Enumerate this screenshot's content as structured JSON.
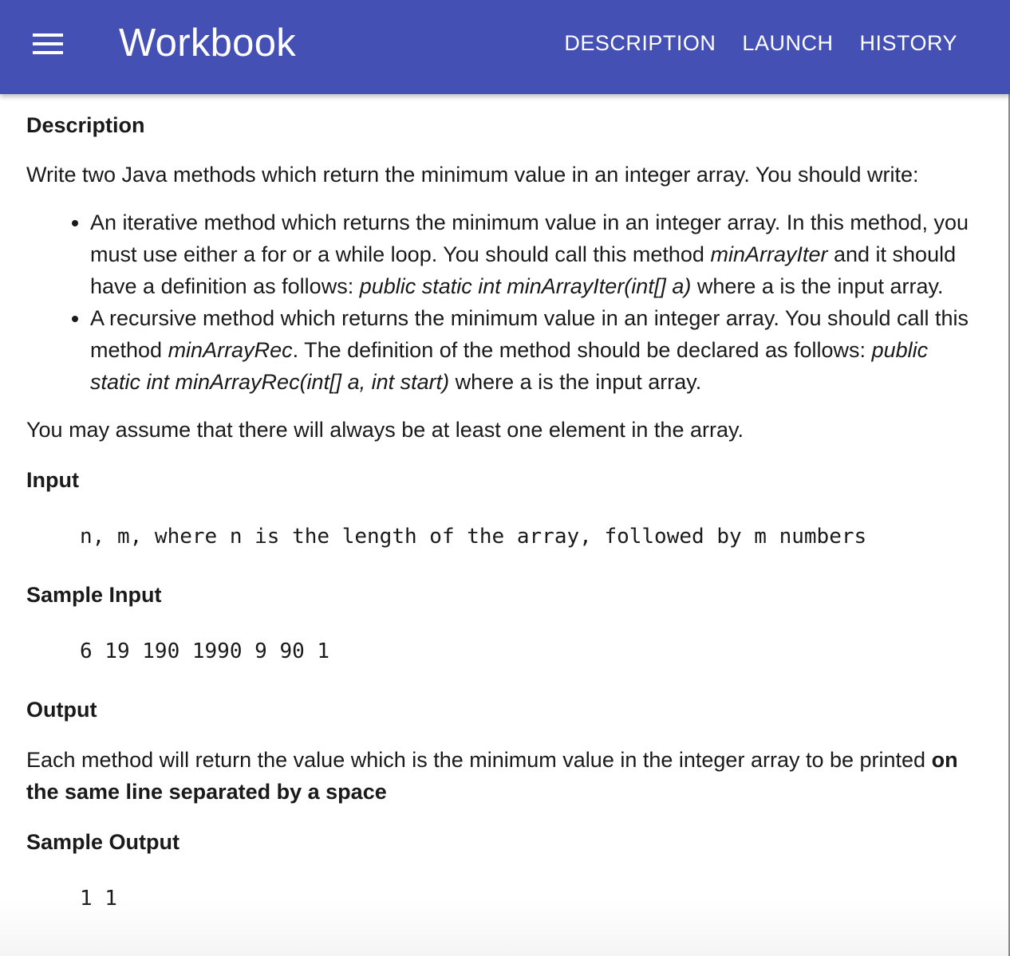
{
  "appbar": {
    "title": "Workbook",
    "nav": [
      "DESCRIPTION",
      "LAUNCH",
      "HISTORY"
    ]
  },
  "colors": {
    "appbar": "#4450b3",
    "text": "#1a1a1a"
  },
  "icons": {
    "menu": "hamburger-menu-icon"
  },
  "content": {
    "description_heading": "Description",
    "intro": "Write two Java methods which return the minimum value in an integer array. You should write:",
    "bullet1": {
      "t1": "An iterative method which returns the minimum value in an integer array. In this method, you must use either a for or a while loop. You should call this method ",
      "name": "minArrayIter",
      "t2": " and it should have a definition as follows: ",
      "signature": "public static int minArrayIter(int[] a)",
      "t3": " where a is the input array."
    },
    "bullet2": {
      "t1": "A recursive method which returns the minimum value in an integer array. You should call this method ",
      "name": "minArrayRec",
      "t2": ". The definition of the method should be declared as follows: ",
      "signature": "public static int minArrayRec(int[] a, int start)",
      "t3": " where a is the input array."
    },
    "assumption": "You may assume that there will always be at least one element in the array.",
    "input_heading": "Input",
    "input_code": "n, m, where n is the length of the array, followed by m numbers",
    "sample_input_heading": "Sample Input",
    "sample_input_code": "6 19 190 1990 9 90 1",
    "output_heading": "Output",
    "output_text": "Each method will return the value which is the minimum value in the integer array to be printed ",
    "output_bold": "on the same line separated by a space",
    "sample_output_heading": "Sample Output",
    "sample_output_code": "1 1"
  }
}
